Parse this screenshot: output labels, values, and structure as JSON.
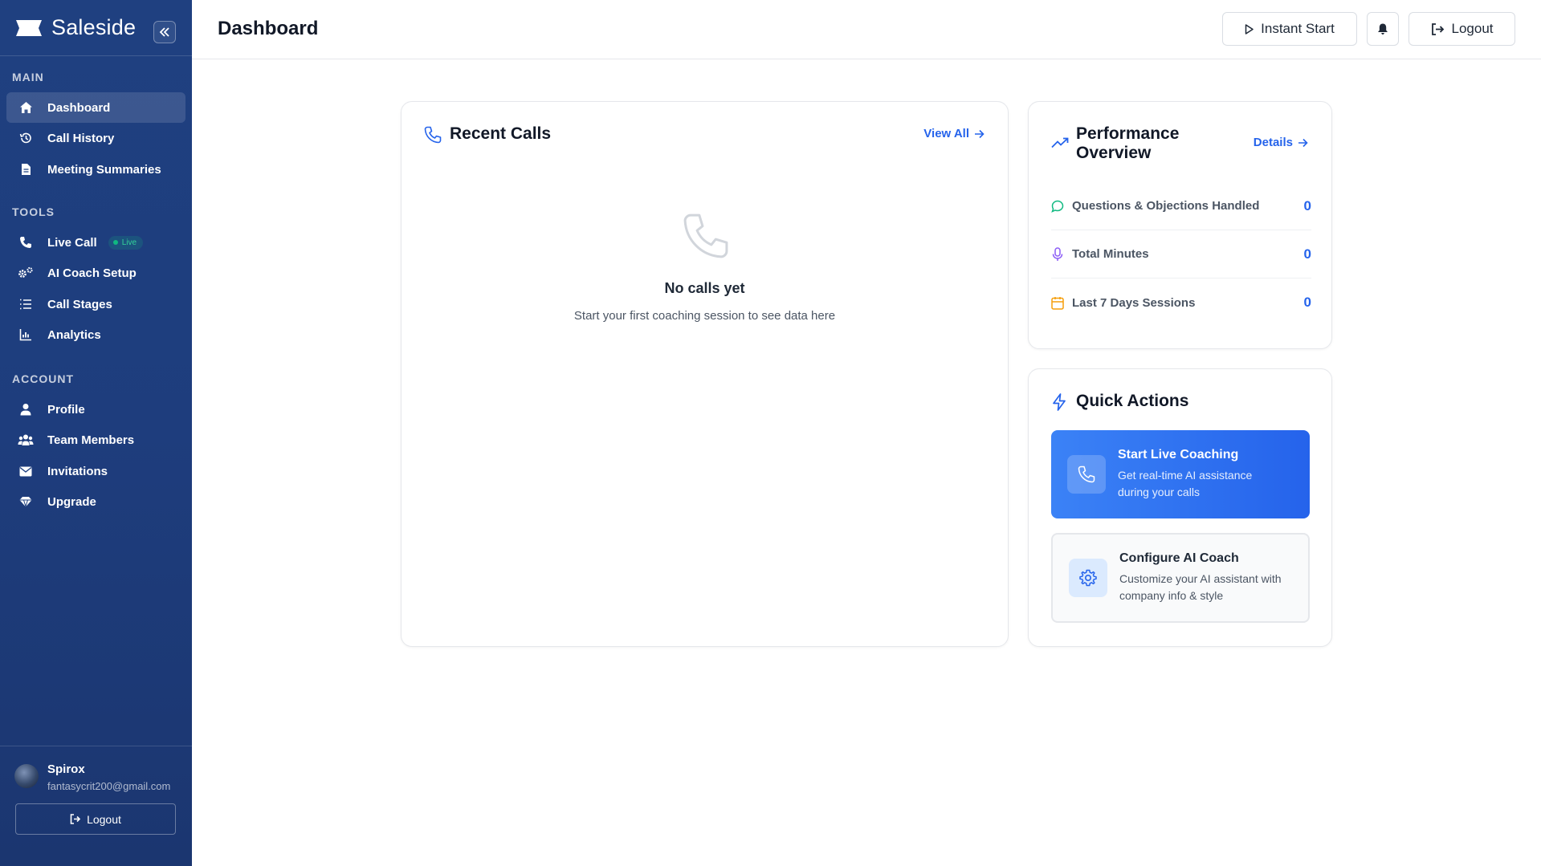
{
  "app": {
    "name": "Saleside"
  },
  "sidebar": {
    "sections": [
      {
        "title": "MAIN"
      },
      {
        "title": "TOOLS"
      },
      {
        "title": "ACCOUNT"
      }
    ],
    "items": [
      {
        "label": "Dashboard",
        "icon": "home-icon",
        "active": true
      },
      {
        "label": "Call History",
        "icon": "history-icon"
      },
      {
        "label": "Meeting Summaries",
        "icon": "document-icon"
      },
      {
        "label": "Live Call",
        "icon": "phone-icon",
        "badge": "Live"
      },
      {
        "label": "AI Coach Setup",
        "icon": "cogs-icon"
      },
      {
        "label": "Call Stages",
        "icon": "list-icon"
      },
      {
        "label": "Analytics",
        "icon": "bar-chart-icon"
      },
      {
        "label": "Profile",
        "icon": "user-icon"
      },
      {
        "label": "Team Members",
        "icon": "users-icon"
      },
      {
        "label": "Invitations",
        "icon": "envelope-icon"
      },
      {
        "label": "Upgrade",
        "icon": "gem-icon"
      }
    ],
    "user": {
      "name": "Spirox",
      "email": "fantasycrit200@gmail.com"
    },
    "logout_label": "Logout"
  },
  "header": {
    "title": "Dashboard",
    "instant_start_label": "Instant Start",
    "logout_label": "Logout"
  },
  "recent_calls": {
    "title": "Recent Calls",
    "view_all_label": "View All",
    "empty_title": "No calls yet",
    "empty_desc": "Start your first coaching session to see data here"
  },
  "performance": {
    "title": "Performance Overview",
    "details_label": "Details",
    "metrics": [
      {
        "label": "Questions & Objections Handled",
        "value": "0",
        "icon": "chat-icon",
        "color": "#10b981"
      },
      {
        "label": "Total Minutes",
        "value": "0",
        "icon": "microphone-icon",
        "color": "#8b5cf6"
      },
      {
        "label": "Last 7 Days Sessions",
        "value": "0",
        "icon": "calendar-icon",
        "color": "#f59e0b"
      }
    ]
  },
  "quick_actions": {
    "title": "Quick Actions",
    "actions": [
      {
        "title": "Start Live Coaching",
        "desc": "Get real-time AI assistance during your calls"
      },
      {
        "title": "Configure AI Coach",
        "desc": "Customize your AI assistant with company info & style"
      }
    ]
  },
  "colors": {
    "accent": "#2563eb",
    "sidebar": "#1e3d7d",
    "live": "#10b981"
  }
}
